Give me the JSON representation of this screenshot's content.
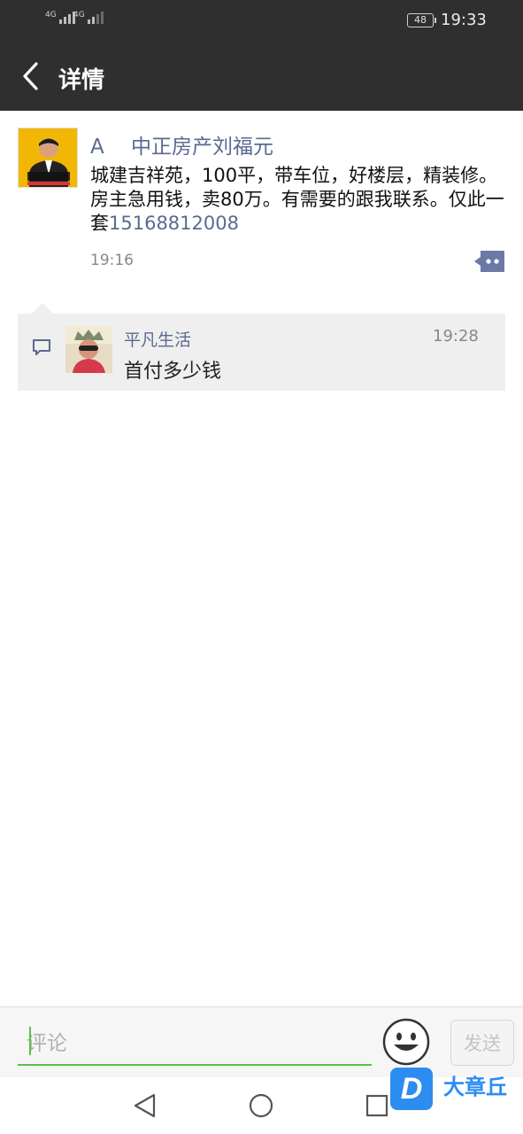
{
  "status_bar": {
    "network_1": "4G",
    "network_2": "4G",
    "battery": "48",
    "time": "19:33"
  },
  "header": {
    "title": "详情",
    "back_icon": "chevron-left-icon"
  },
  "post": {
    "author": "A　 中正房产刘福元",
    "text": "城建吉祥苑，100平，带车位，好楼层，精装修。房主急用钱，卖80万。有需要的跟我联系。仅此一套",
    "phone": "15168812008",
    "time": "19:16",
    "avatar_text": "中正房产",
    "more_icon": "more-dots-icon"
  },
  "comments": [
    {
      "name": "平凡生活",
      "time": "19:28",
      "text": "首付多少钱"
    }
  ],
  "input_bar": {
    "placeholder": "评论",
    "send_label": "发送",
    "emoji_icon": "smiley-icon"
  },
  "nav": {
    "back": "nav-back-icon",
    "home": "nav-home-icon",
    "recent": "nav-recent-icon"
  },
  "watermark": {
    "logo_letter": "D",
    "text": "大章丘"
  },
  "colors": {
    "header_bg": "#2f2f2f",
    "name_blue": "#5a6a90",
    "accent_green": "#5cbf4a",
    "comment_bg": "#efefef",
    "watermark_blue": "#2d8cf0"
  }
}
